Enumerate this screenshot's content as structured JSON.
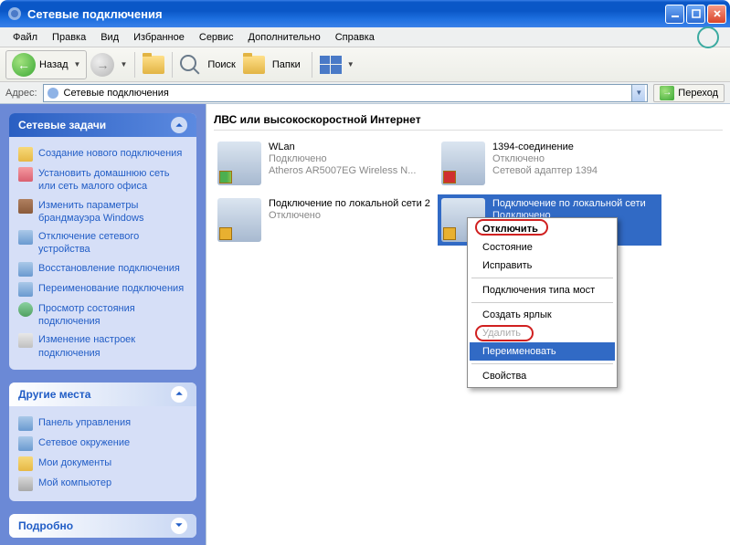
{
  "window": {
    "title": "Сетевые подключения"
  },
  "menu": {
    "file": "Файл",
    "edit": "Правка",
    "view": "Вид",
    "favorites": "Избранное",
    "service": "Сервис",
    "advanced": "Дополнительно",
    "help": "Справка"
  },
  "toolbar": {
    "back": "Назад",
    "search": "Поиск",
    "folders": "Папки"
  },
  "address": {
    "label": "Адрес:",
    "value": "Сетевые подключения",
    "go": "Переход"
  },
  "sidebar": {
    "tasks_title": "Сетевые задачи",
    "tasks": [
      "Создание нового подключения",
      "Установить домашнюю сеть или сеть малого офиса",
      "Изменить параметры брандмауэра Windows",
      "Отключение сетевого устройства",
      "Восстановление подключения",
      "Переименование подключения",
      "Просмотр состояния подключения",
      "Изменение настроек подключения"
    ],
    "places_title": "Другие места",
    "places": [
      "Панель управления",
      "Сетевое окружение",
      "Мои документы",
      "Мой компьютер"
    ],
    "details_title": "Подробно"
  },
  "content": {
    "section": "ЛВС или высокоскоростной Интернет",
    "conns": [
      {
        "name": "WLan",
        "status": "Подключено",
        "device": "Atheros AR5007EG Wireless N..."
      },
      {
        "name": "1394-соединение",
        "status": "Отключено",
        "device": "Сетевой адаптер 1394"
      },
      {
        "name": "Подключение по локальной сети 2",
        "status": "Отключено",
        "device": ""
      },
      {
        "name": "Подключение по локальной сети",
        "status": "Подключено",
        "device": ""
      }
    ]
  },
  "context": {
    "disable": "Отключить",
    "status": "Состояние",
    "repair": "Исправить",
    "bridge": "Подключения типа мост",
    "shortcut": "Создать ярлык",
    "delete": "Удалить",
    "rename": "Переименовать",
    "properties": "Свойства"
  }
}
